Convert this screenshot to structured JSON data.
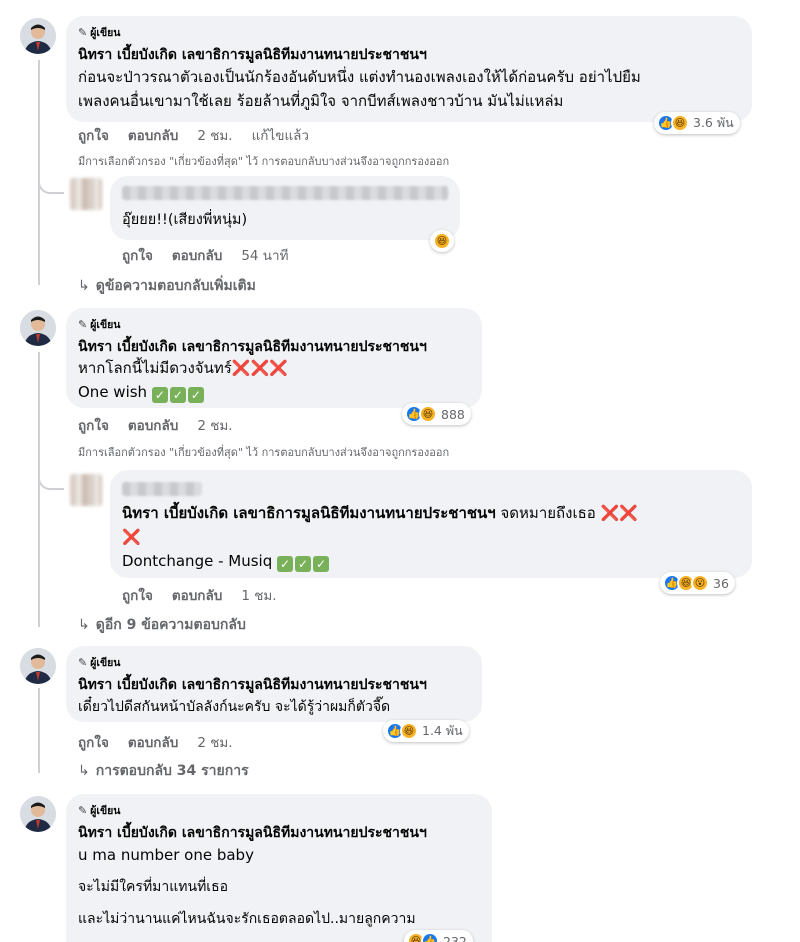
{
  "labels": {
    "author_badge": "ผู้เขียน",
    "like": "ถูกใจ",
    "reply": "ตอบกลับ",
    "edited": "แก้ไขแล้ว",
    "filter_note": "มีการเลือกตัวกรอง \"เกี่ยวข้องที่สุด\" ไว้ การตอบกลับบางส่วนจึงอาจถูกกรองออก"
  },
  "comments": [
    {
      "author": "นิทรา เบี้ยบังเกิด เลขาธิการมูลนิธิทีมงานทนายประชาชนฯ",
      "lines": [
        "ก่อนจะป่าวรณาตัวเองเป็นนักร้องอันดับหนึ่ง แต่งทำนองเพลงเองให้ได้ก่อนครับ อย่าไปยืม",
        "เพลงคนอื่นเขามาใช้เลย ร้อยล้านที่ภูมิใจ จากบีทส์เพลงชาวบ้าน มันไม่แหล่ม"
      ],
      "time": "2 ชม.",
      "reactions": "3.6 พัน",
      "reply": {
        "text": "อุ๊ยยย!!(เสียงพี่หนุ่ม)",
        "time": "54 นาที"
      },
      "view_more": "ดูข้อความตอบกลับเพิ่มเติม"
    },
    {
      "author": "นิทรา เบี้ยบังเกิด เลขาธิการมูลนิธิทีมงานทนายประชาชนฯ",
      "line1": "หากโลกนี้ไม่มีดวงจันทร์",
      "line2": "One wish",
      "time": "2 ชม.",
      "reactions": "888",
      "reply": {
        "author": "นิทรา เบี้ยบังเกิด เลขาธิการมูลนิธิทีมงานทนายประชาชนฯ",
        "text_suffix": "จดหมายถึงเธอ",
        "line2": "Dontchange - Musiq",
        "time": "1 ชม.",
        "reactions": "36"
      },
      "view_more": "ดูอีก 9 ข้อความตอบกลับ"
    },
    {
      "author": "นิทรา เบี้ยบังเกิด เลขาธิการมูลนิธิทีมงานทนายประชาชนฯ",
      "line1": "เดี๋ยวไปดีสกันหน้าบัลลังก์นะครับ จะได้รู้ว่าผมก็ตัวจี๊ด",
      "time": "2 ชม.",
      "reactions": "1.4 พัน",
      "view_more": "การตอบกลับ 34 รายการ"
    },
    {
      "author": "นิทรา เบี้ยบังเกิด เลขาธิการมูลนิธิทีมงานทนายประชาชนฯ",
      "line1": "u ma number one baby",
      "line2": "จะไม่มีใครที่มาแทนที่เธอ",
      "line3": "และไม่ว่านานแค่ไหนฉันจะรักเธอตลอดไป..มายลูกความ",
      "reactions": "232"
    }
  ],
  "colors": {
    "like": "#1877f2",
    "haha": "#f7b125",
    "bubble": "#f0f2f5",
    "meta": "#65676b"
  }
}
